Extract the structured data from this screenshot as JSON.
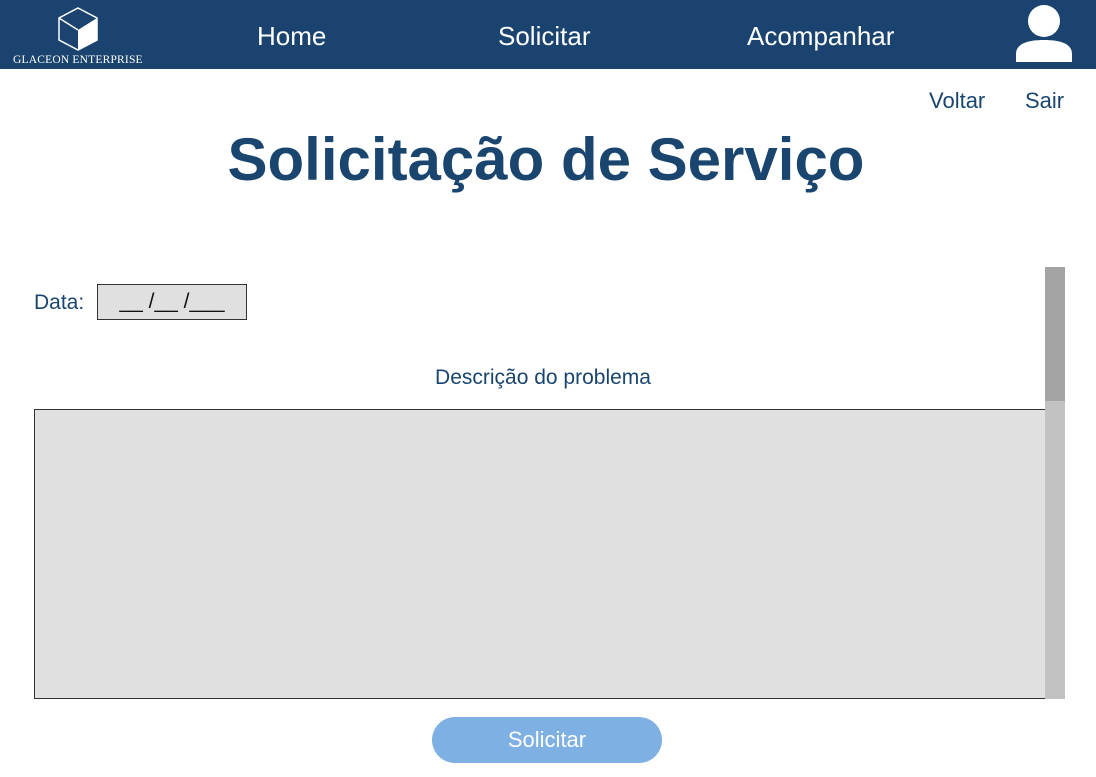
{
  "header": {
    "logo_text": "GLACEON ENTERPRISE",
    "nav": {
      "home": "Home",
      "solicitar": "Solicitar",
      "acompanhar": "Acompanhar"
    },
    "user_icon": "user-avatar-icon",
    "logo_icon": "cube-icon"
  },
  "subnav": {
    "voltar": "Voltar",
    "sair": "Sair"
  },
  "page": {
    "title": "Solicitação de Serviço"
  },
  "form": {
    "date_label": "Data:",
    "date_value": "__ /__ /___",
    "description_label": "Descrição do problema",
    "description_value": "",
    "submit_label": "Solicitar"
  },
  "colors": {
    "header_bg": "#1a446f",
    "text_primary": "#1a456f",
    "field_bg": "#e0e0e0",
    "button_bg": "#7eb0e3",
    "scroll_track": "#c2c2c2",
    "scroll_thumb": "#a4a4a4"
  }
}
